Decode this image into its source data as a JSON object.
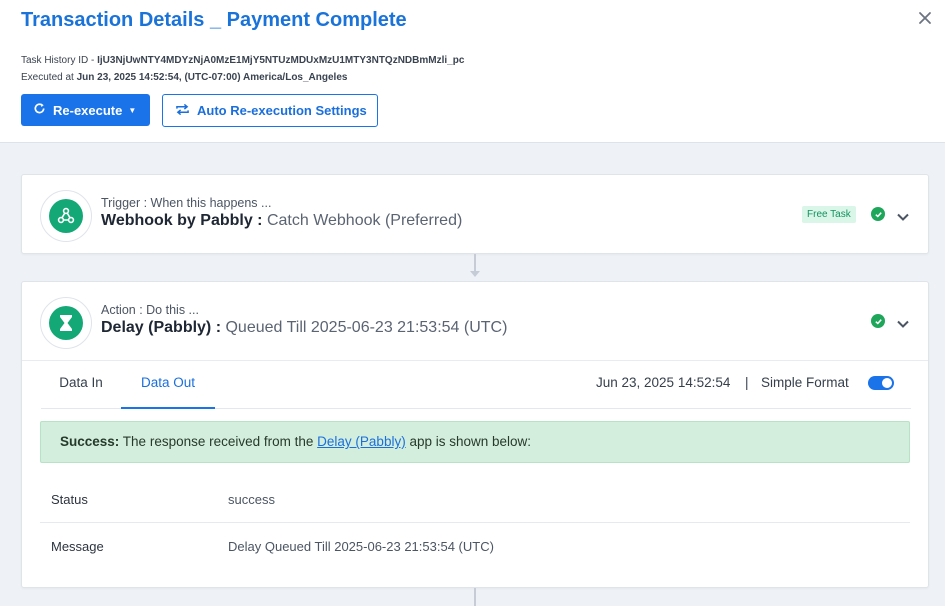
{
  "header": {
    "title": "Transaction Details _ Payment Complete",
    "task_history_label": "Task History ID - ",
    "task_history_id": "IjU3NjUwNTY4MDYzNjA0MzE1MjY5NTUzMDUxMzU1MTY3NTQzNDBmMzli_pc",
    "executed_label": "Executed at ",
    "executed_value": "Jun 23, 2025 14:52:54, (UTC-07:00) America/Los_Angeles",
    "reexecute_label": "Re-execute",
    "auto_settings_label": "Auto Re-execution Settings"
  },
  "trigger": {
    "label": "Trigger : When this happens ...",
    "app": "Webhook by Pabbly :",
    "event": "Catch Webhook (Preferred)",
    "badge": "Free Task",
    "status": "success"
  },
  "action": {
    "label": "Action : Do this ...",
    "app": "Delay (Pabbly) :",
    "event": "Queued Till 2025-06-23 21:53:54 (UTC)",
    "status": "success",
    "tabs": [
      "Data In",
      "Data Out"
    ],
    "active_tab": "Data Out",
    "timestamp": "Jun 23, 2025 14:52:54",
    "separator": "|",
    "simple_format_label": "Simple Format",
    "simple_format_on": true,
    "message": {
      "strong": "Success:",
      "before": " The response received from the ",
      "link": "Delay (Pabbly)",
      "after": " app is shown below:"
    },
    "rows": [
      {
        "key": "Status",
        "value": "success"
      },
      {
        "key": "Message",
        "value": "Delay Queued Till 2025-06-23 21:53:54 (UTC)"
      }
    ]
  },
  "colors": {
    "accent": "#1a73e8",
    "title": "#1a73d9",
    "success_green": "#1ea65b",
    "app_green": "#15a877",
    "success_bg": "#d4eedd"
  },
  "icons": {
    "close": "close-icon",
    "reexecute": "refresh-icon",
    "auto": "repeat-icon",
    "trigger_app": "webhook-icon",
    "action_app": "hourglass-icon",
    "check": "check-circle-icon",
    "expand": "chevron-down-icon"
  }
}
